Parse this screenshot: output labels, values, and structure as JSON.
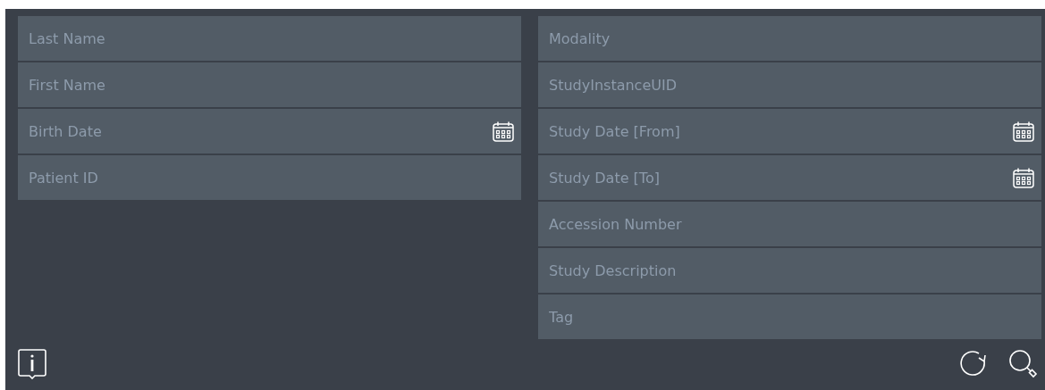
{
  "patient_fields": [
    {
      "placeholder": "Last Name",
      "kind": "text"
    },
    {
      "placeholder": "First Name",
      "kind": "text"
    },
    {
      "placeholder": "Birth Date",
      "kind": "date"
    },
    {
      "placeholder": "Patient ID",
      "kind": "text"
    }
  ],
  "study_fields": [
    {
      "placeholder": "Modality",
      "kind": "text"
    },
    {
      "placeholder": "StudyInstanceUID",
      "kind": "text"
    },
    {
      "placeholder": "Study Date [From]",
      "kind": "date"
    },
    {
      "placeholder": "Study Date [To]",
      "kind": "date"
    },
    {
      "placeholder": "Accession Number",
      "kind": "text"
    },
    {
      "placeholder": "Study Description",
      "kind": "text"
    },
    {
      "placeholder": "Tag",
      "kind": "text"
    }
  ]
}
